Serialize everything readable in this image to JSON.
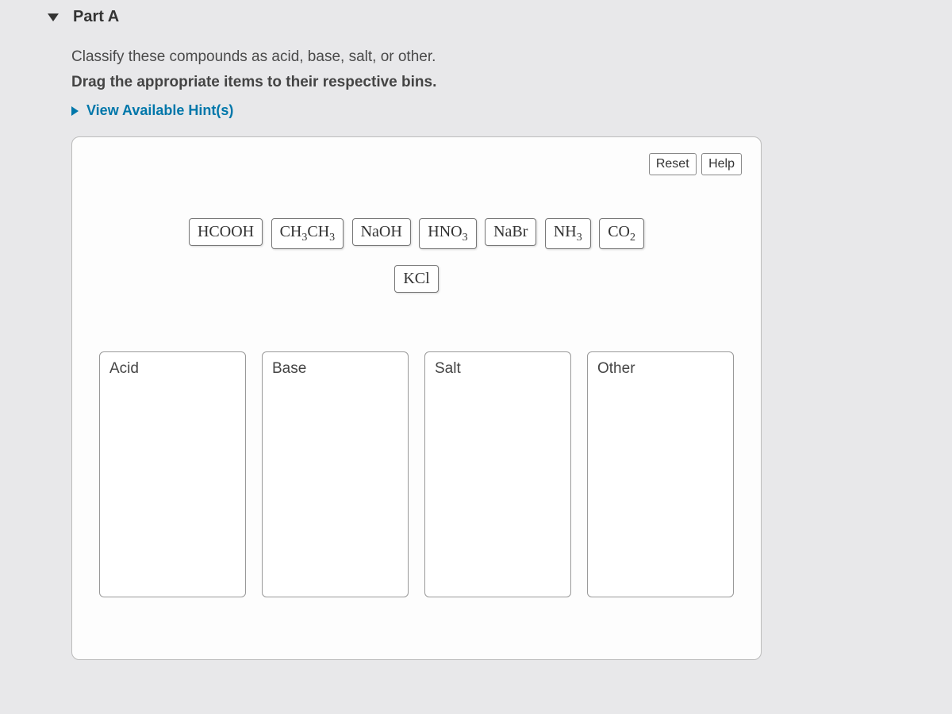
{
  "part": {
    "label": "Part A"
  },
  "question": "Classify these compounds as acid, base, salt, or other.",
  "instruction": "Drag the appropriate items to their respective bins.",
  "hints": {
    "label": "View Available Hint(s)"
  },
  "buttons": {
    "reset": "Reset",
    "help": "Help"
  },
  "chips": {
    "hcooh": "HCOOH",
    "ch3ch3": "CH<sub>3</sub>CH<sub>3</sub>",
    "naoh": "NaOH",
    "hno3": "HNO<sub>3</sub>",
    "nabr": "NaBr",
    "nh3": "NH<sub>3</sub>",
    "co2": "CO<sub>2</sub>",
    "kcl": "KCl"
  },
  "bins": {
    "acid": "Acid",
    "base": "Base",
    "salt": "Salt",
    "other": "Other"
  }
}
